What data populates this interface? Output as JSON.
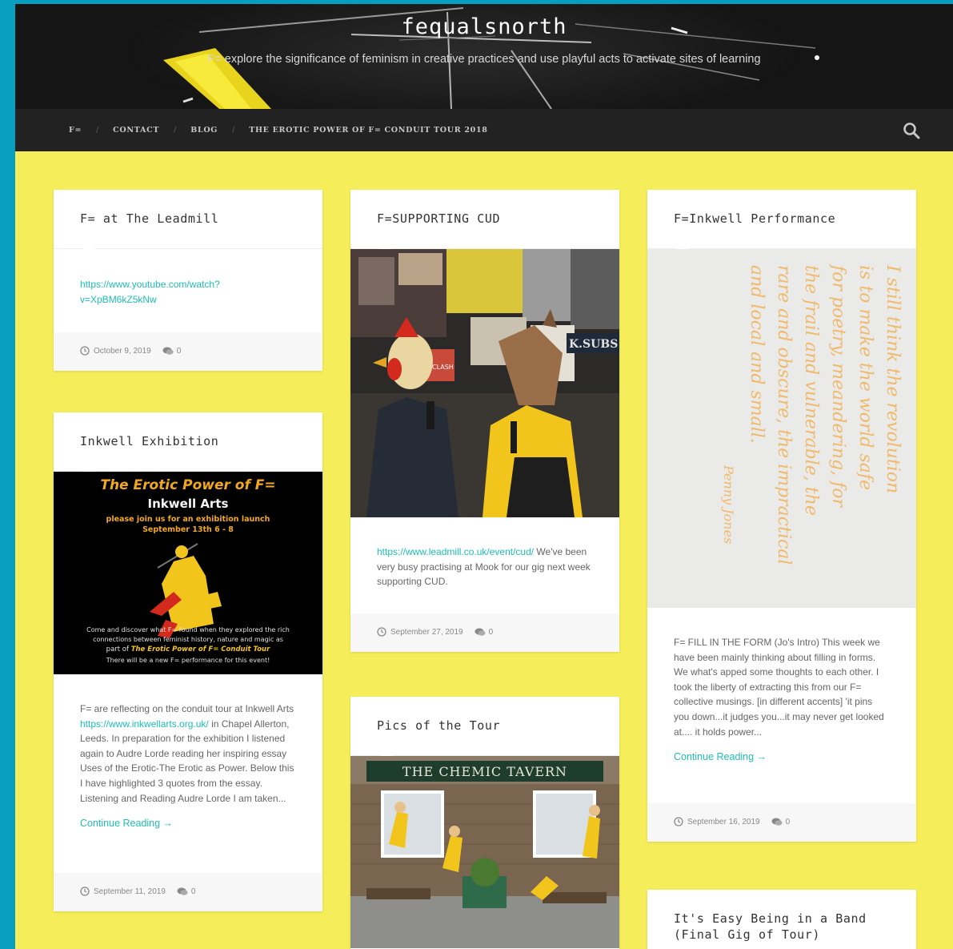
{
  "site": {
    "title": "fequalsnorth",
    "tagline": "F= explore the significance of feminism in creative practices and use playful acts to activate sites of learning"
  },
  "nav": {
    "items": [
      "F=",
      "CONTACT",
      "BLOG",
      "THE EROTIC POWER OF F= CONDUIT TOUR 2018"
    ],
    "separator": "/",
    "search_icon": "search-icon"
  },
  "colors": {
    "page_bg": "#f5ee5a",
    "frame": "#079ec0",
    "header_bg": "#141414",
    "nav_bg": "#222222",
    "link": "#1dbeb4"
  },
  "posts": [
    {
      "title": "F= at The Leadmill",
      "link": "https://www.youtube.com/watch?v=XpBM6kZ5kNw",
      "link_line1": "https://www.youtube.com/watch?",
      "link_line2": "v=XpBM6kZ5kNw",
      "date": "October 9, 2019",
      "comments": "0"
    },
    {
      "title": "F=SUPPORTING CUD",
      "link": "https://www.leadmill.co.uk/event/cud/",
      "excerpt": " We've been very busy practising at Mook for our gig next week supporting CUD.",
      "image_text_sign": "K.SUBS",
      "image_text_poster": "CLASH",
      "date": "September 27, 2019",
      "comments": "0"
    },
    {
      "title": "F=Inkwell Performance",
      "image_text": [
        "I still think the revolution",
        "is to make the world safe",
        "for poetry, meandering, for",
        "the frail and vulnerable, the",
        "rare and obscure, the impractical",
        "and local and small."
      ],
      "image_text_signature": "Penny Jones",
      "excerpt": "F= FILL IN THE FORM (Jo's Intro) This week we have been mainly thinking about filling in forms. We what's apped some thoughts to each other.  I took the liberty of extracting this from our F= collective musings. [in different accents] 'it pins you down...it judges you...it may never get looked at.... it holds power...",
      "continue": "Continue Reading →",
      "date": "September 16, 2019",
      "comments": "0"
    },
    {
      "title": "Inkwell Exhibition",
      "poster": {
        "title": "The Erotic Power of F=",
        "venue": "Inkwell Arts",
        "invite": "please join us for an exhibition launch",
        "dates": "September 13th 6 - 8",
        "line1": "Come and discover what F= found when they explored the rich",
        "line2": "connections between feminist history, nature and magic as",
        "line3_prefix": "part of ",
        "line3_em": "The Erotic Power of F= Conduit Tour",
        "line4": "There will be a new F= performance for this event!"
      },
      "excerpt_start": "F= are reflecting on the conduit tour at Inkwell Arts ",
      "link": "https://www.inkwellarts.org.uk/",
      "excerpt_end": " in Chapel Allerton, Leeds. In preparation for the exhibition I listened again to Audre Lorde reading her inspiring essay Uses of the Erotic-The Erotic as Power. Below this I have highlighted 3 quotes from the essay. Listening and Reading Audre Lorde I am taken...",
      "continue": "Continue Reading →",
      "date": "September 11, 2019",
      "comments": "0"
    },
    {
      "title": "Pics of the Tour",
      "image_text_sign": "THE CHEMIC TAVERN"
    },
    {
      "title": "It's Easy Being in a Band (Final Gig of Tour)"
    }
  ]
}
